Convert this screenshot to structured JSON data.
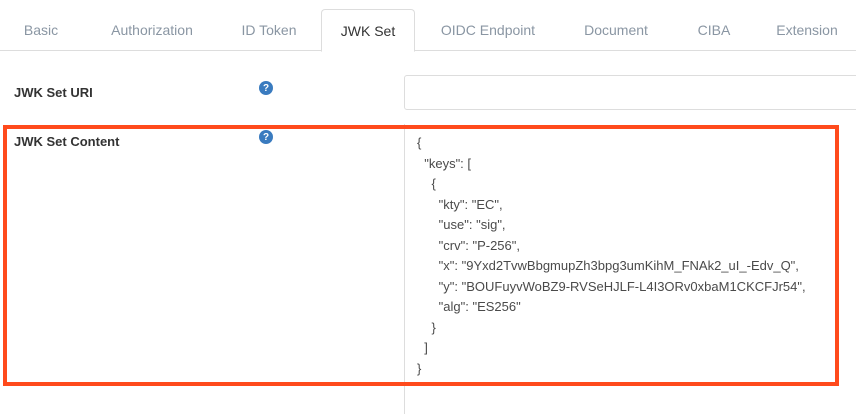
{
  "tabs": [
    {
      "label": "Basic"
    },
    {
      "label": "Authorization"
    },
    {
      "label": "ID Token"
    },
    {
      "label": "JWK Set",
      "active": true
    },
    {
      "label": "OIDC Endpoint"
    },
    {
      "label": "Document"
    },
    {
      "label": "CIBA"
    },
    {
      "label": "Extension"
    }
  ],
  "fields": {
    "jwk_set_uri": {
      "label": "JWK Set URI",
      "value": "",
      "help_icon": "question-circle-icon"
    },
    "jwk_set_content": {
      "label": "JWK Set Content",
      "help_icon": "question-circle-icon",
      "lines": [
        "{",
        "  \"keys\": [",
        "    {",
        "      \"kty\": \"EC\",",
        "      \"use\": \"sig\",",
        "      \"crv\": \"P-256\",",
        "      \"x\": \"9Yxd2TvwBbgmupZh3bpg3umKihM_FNAk2_uI_-Edv_Q\",",
        "      \"y\": \"BOUFuyvWoBZ9-RVSeHJLF-L4I3ORv0xbaM1CKCFJr54\",",
        "      \"alg\": \"ES256\"",
        "    }",
        "  ]",
        "}"
      ]
    }
  },
  "colors": {
    "highlight_border": "#ff4a1c",
    "help_icon": "#3a7bbf",
    "tab_inactive_text": "#8a96a3"
  }
}
